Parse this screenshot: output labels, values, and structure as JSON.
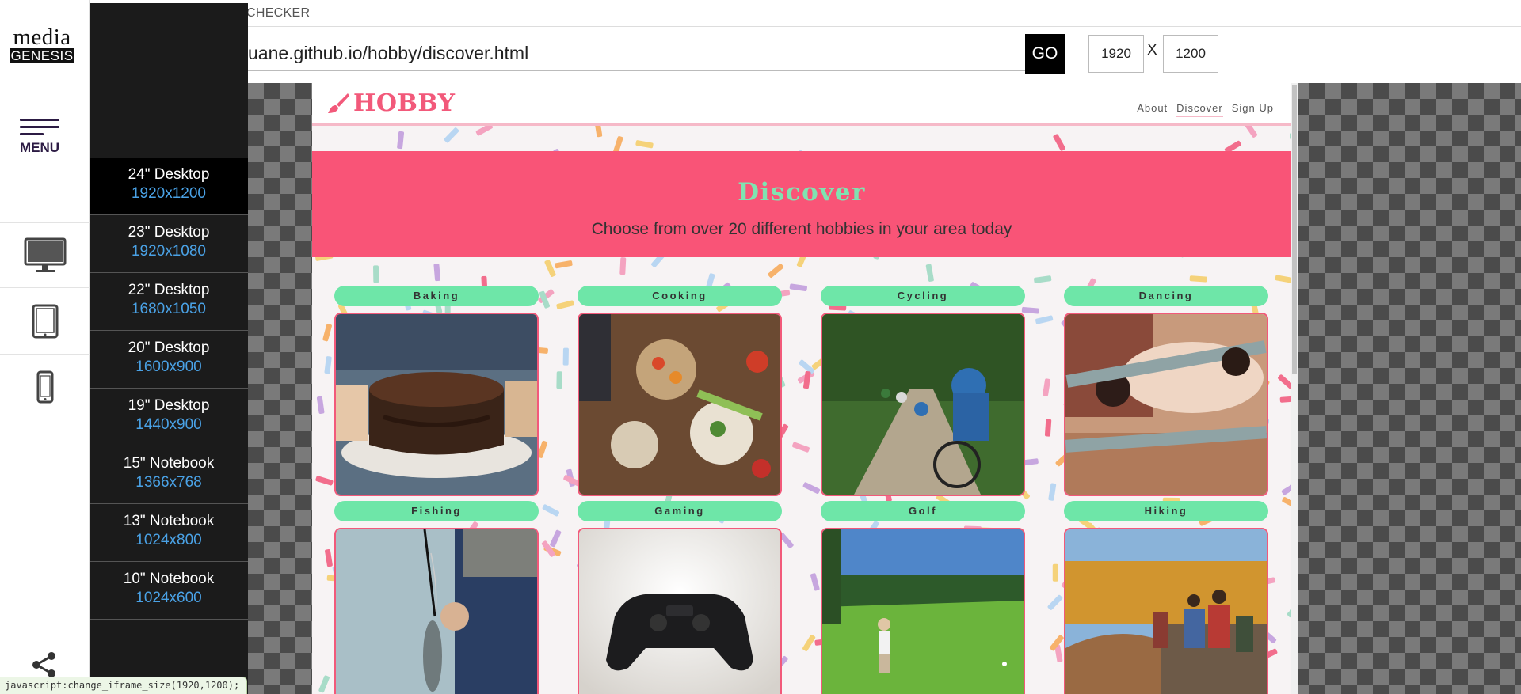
{
  "app": {
    "logo_line1": "media",
    "logo_line2": "GENESIS",
    "menu_label": "MENU",
    "top_title": "CHECKER",
    "url": "uane.github.io/hobby/discover.html",
    "go_label": "GO",
    "width_value": "1920",
    "x_label": "X",
    "height_value": "1200",
    "status_text": "javascript:change_iframe_size(1920,1200);"
  },
  "device_icons": [
    "desktop-icon",
    "tablet-icon",
    "phone-icon"
  ],
  "device_menu": [
    {
      "name": "24\" Desktop",
      "res": "1920x1200",
      "active": true
    },
    {
      "name": "23\" Desktop",
      "res": "1920x1080"
    },
    {
      "name": "22\" Desktop",
      "res": "1680x1050"
    },
    {
      "name": "20\" Desktop",
      "res": "1600x900"
    },
    {
      "name": "19\" Desktop",
      "res": "1440x900"
    },
    {
      "name": "15\" Notebook",
      "res": "1366x768"
    },
    {
      "name": "13\" Notebook",
      "res": "1024x800"
    },
    {
      "name": "10\" Notebook",
      "res": "1024x600"
    }
  ],
  "site": {
    "brand": "HOBBY",
    "nav": [
      "About",
      "Discover",
      "Sign Up"
    ],
    "nav_current": "Discover",
    "hero_title": "Discover",
    "hero_subtitle": "Choose from over 20 different hobbies in your area today",
    "hobbies": [
      "Baking",
      "Cooking",
      "Cycling",
      "Dancing",
      "Fishing",
      "Gaming",
      "Golf",
      "Hiking"
    ]
  },
  "colors": {
    "brand_pink": "#f2597a",
    "hero_bg": "#f95477",
    "hero_title": "#7fe3b1",
    "pill_green": "#6ee6a8",
    "resolution_blue": "#4aa2e6",
    "menu_dark": "#1b1b1b"
  }
}
